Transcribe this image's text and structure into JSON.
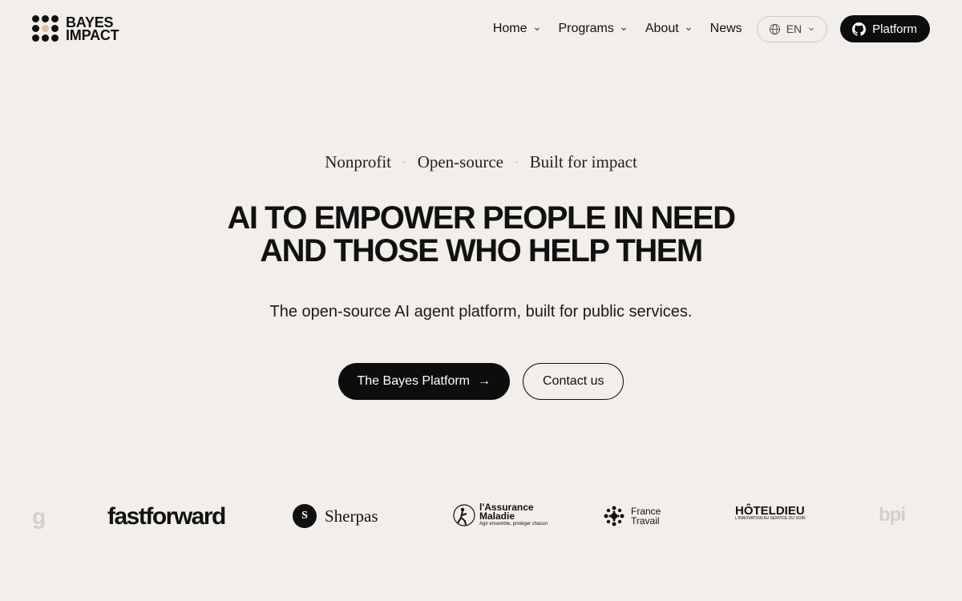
{
  "brand": {
    "line1": "BAYES",
    "line2": "IMPACT"
  },
  "nav": {
    "items": [
      {
        "label": "Home",
        "has_dropdown": true
      },
      {
        "label": "Programs",
        "has_dropdown": true
      },
      {
        "label": "About",
        "has_dropdown": true
      },
      {
        "label": "News",
        "has_dropdown": false
      }
    ],
    "language": "EN",
    "platform_label": "Platform"
  },
  "hero": {
    "tags": [
      "Nonprofit",
      "Open-source",
      "Built for impact"
    ],
    "separator": "·",
    "headline_line1": "AI TO EMPOWER PEOPLE IN NEED",
    "headline_line2": "AND THOSE WHO HELP THEM",
    "subtitle": "The open-source AI agent platform, built for public services.",
    "primary_cta": "The Bayes Platform",
    "primary_cta_arrow": "→",
    "secondary_cta": "Contact us"
  },
  "partners": {
    "g_partial": "g",
    "fastforward": "fastforward",
    "sherpas": "Sherpas",
    "sherpas_mark": "S",
    "assurance_line1": "l'Assurance",
    "assurance_line2": "Maladie",
    "assurance_tagline": "Agir ensemble, protéger chacun",
    "france_travail_line1": "France",
    "france_travail_line2": "Travail",
    "hotel_dieu": "HÔTELDIEU",
    "hotel_dieu_tagline": "L'INNOVATION AU SERVICE DU SOIN",
    "bpi_partial": "bpi"
  },
  "colors": {
    "background": "#f2efea",
    "primary": "#0d0d0d",
    "logo_accent": "#d6c4a4"
  }
}
